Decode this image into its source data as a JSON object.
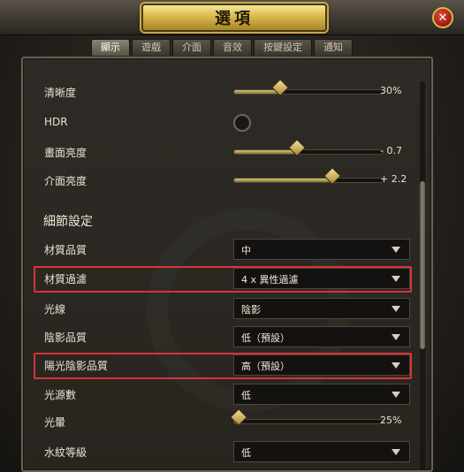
{
  "window": {
    "title": "選項",
    "close_symbol": "✕"
  },
  "tabs": [
    {
      "label": "顯示",
      "active": true
    },
    {
      "label": "遊戲",
      "active": false
    },
    {
      "label": "介面",
      "active": false
    },
    {
      "label": "音效",
      "active": false
    },
    {
      "label": "按鍵設定",
      "active": false
    },
    {
      "label": "通知",
      "active": false
    }
  ],
  "display": {
    "sharpness": {
      "label": "清晰度",
      "value_text": "30%",
      "fill": 0.3
    },
    "hdr": {
      "label": "HDR",
      "enabled": false
    },
    "brightness": {
      "label": "畫面亮度",
      "value_text": "- 0.7",
      "fill": 0.41
    },
    "ui_brightness": {
      "label": "介面亮度",
      "value_text": "+ 2.2",
      "fill": 0.65
    }
  },
  "detail": {
    "title": "細節設定",
    "texture_quality": {
      "label": "材質品質",
      "value": "中"
    },
    "texture_filter": {
      "label": "材質過濾",
      "value": "4 x 異性過濾",
      "highlighted": true
    },
    "lighting": {
      "label": "光線",
      "value": "陰影"
    },
    "shadow_quality": {
      "label": "陰影品質",
      "value": "低（預設）"
    },
    "sun_shadow_quality": {
      "label": "陽光陰影品質",
      "value": "高（預設）",
      "highlighted": true
    },
    "light_sources": {
      "label": "光源數",
      "value": "低"
    },
    "bloom": {
      "label": "光暈",
      "value_text": "25%",
      "fill": 0.02
    },
    "water_level": {
      "label": "水紋等級",
      "value": "低"
    }
  },
  "colors": {
    "accent_gold": "#d9b94d",
    "highlight_red": "#d8323a"
  }
}
